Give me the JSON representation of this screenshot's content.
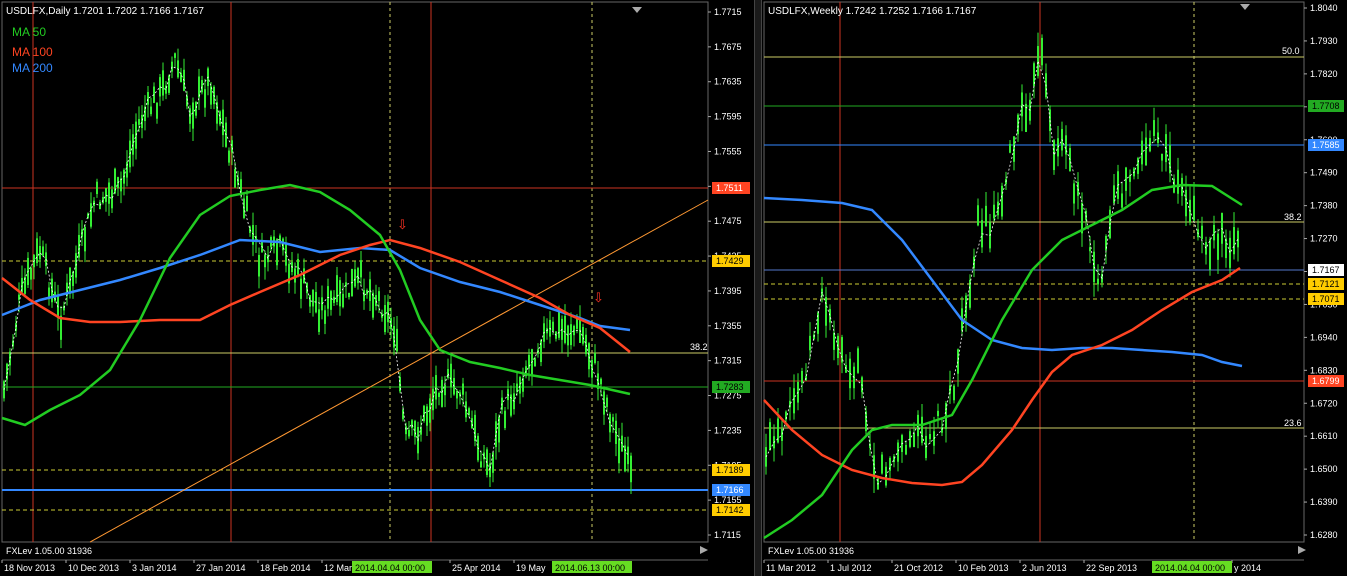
{
  "left": {
    "symbol": "USDLFX,Daily",
    "ohlc": "1.7201 1.7202 1.7166 1.7167",
    "legend": [
      {
        "label": "MA 50",
        "color": "#22cc22"
      },
      {
        "label": "MA 100",
        "color": "#ff4422"
      },
      {
        "label": "MA 200",
        "color": "#3388ff"
      }
    ],
    "footer": "FXLev 1.05.00 31936",
    "y_ticks": [
      "1.7715",
      "1.7675",
      "1.7635",
      "1.7595",
      "1.7555",
      "1.7515",
      "1.7475",
      "1.7435",
      "1.7395",
      "1.7355",
      "1.7315",
      "1.7275",
      "1.7235",
      "1.7195",
      "1.7155",
      "1.7115"
    ],
    "x_ticks": [
      "18 Nov 2013",
      "10 Dec 2013",
      "3 Jan 2014",
      "27 Jan 2014",
      "18 Feb 2014",
      "12 Mar",
      "25 Apr 2014",
      "19 May"
    ],
    "x_highlights": [
      "2014.04.04 00:00",
      "2014.06.13 00:00"
    ],
    "level_labels": [
      {
        "value": "1.7511",
        "color": "#ff4422",
        "text_color": "#ffffff"
      },
      {
        "value": "1.7429",
        "color": "#ffcc00",
        "text_color": "#000000"
      },
      {
        "value": "1.7283",
        "color": "#22aa22",
        "text_color": "#000000"
      },
      {
        "value": "1.7189",
        "color": "#ffcc00",
        "text_color": "#000000"
      },
      {
        "value": "1.7166",
        "color": "#3388ff",
        "text_color": "#ffffff"
      },
      {
        "value": "1.7142",
        "color": "#ffcc00",
        "text_color": "#000000"
      }
    ],
    "fib_label": "38.2"
  },
  "right": {
    "symbol": "USDLFX,Weekly",
    "ohlc": "1.7242 1.7252 1.7166 1.7167",
    "footer": "FXLev 1.05.00 31936",
    "y_ticks": [
      "1.8040",
      "1.7930",
      "1.7820",
      "1.7710",
      "1.7600",
      "1.7490",
      "1.7380",
      "1.7270",
      "1.7160",
      "1.7050",
      "1.6940",
      "1.6830",
      "1.6720",
      "1.6610",
      "1.6500",
      "1.6390",
      "1.6280"
    ],
    "x_ticks": [
      "11 Mar 2012",
      "1 Jul 2012",
      "21 Oct 2012",
      "10 Feb 2013",
      "2 Jun 2013",
      "22 Sep 2013",
      "y 2014"
    ],
    "x_highlights": [
      "2014.04.04 00:00"
    ],
    "level_labels": [
      {
        "value": "1.7708",
        "color": "#22aa22",
        "text_color": "#000000"
      },
      {
        "value": "1.7585",
        "color": "#3388ff",
        "text_color": "#ffffff"
      },
      {
        "value": "1.7167",
        "color": "#ffffff",
        "text_color": "#000000"
      },
      {
        "value": "1.7121",
        "color": "#ffcc00",
        "text_color": "#000000"
      },
      {
        "value": "1.7071",
        "color": "#ffcc00",
        "text_color": "#000000"
      },
      {
        "value": "1.6799",
        "color": "#ff4422",
        "text_color": "#ffffff"
      }
    ],
    "fib_labels": [
      "50.0",
      "38.2",
      "23.6"
    ]
  },
  "colors": {
    "candle": "#33ee33",
    "grid_red": "#cc3322",
    "grid_yellow": "#cccc66",
    "background": "#000000"
  }
}
